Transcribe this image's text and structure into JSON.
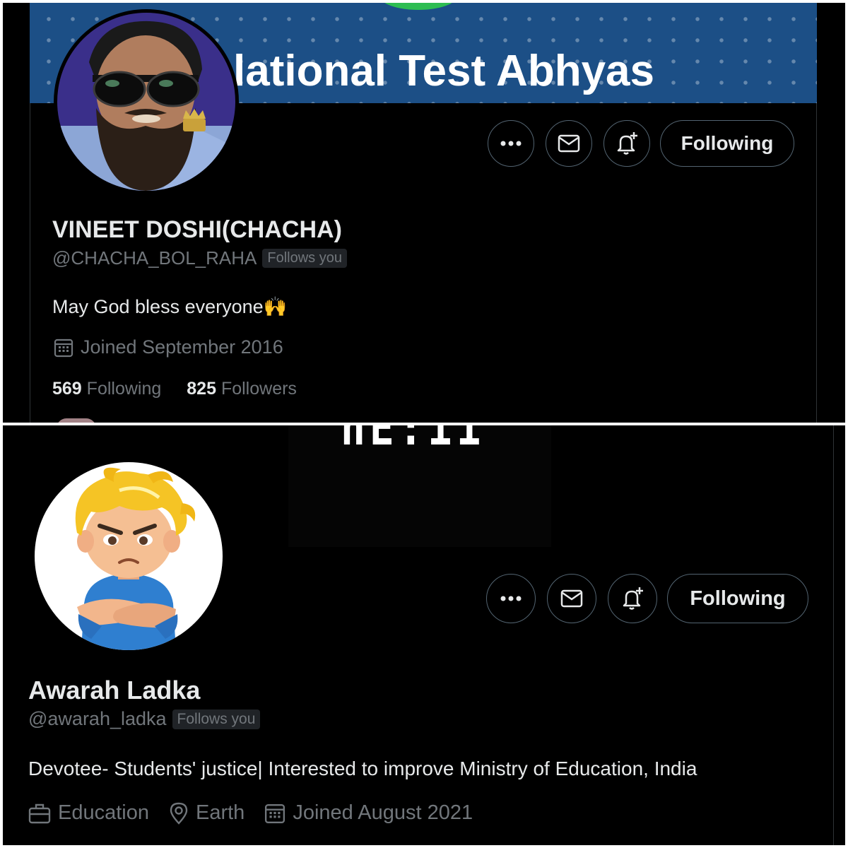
{
  "profiles": [
    {
      "banner_text": "lational Test Abhyas",
      "actions": {
        "more_label": "•••",
        "following_label": "Following"
      },
      "name": "VINEET DOSHI(CHACHA)",
      "handle": "@CHACHA_BOL_RAHA",
      "follows_you": "Follows you",
      "bio": "May God bless everyone🙌",
      "joined": "Joined September 2016",
      "following_count": "569",
      "following_label": "Following",
      "followers_count": "825",
      "followers_label": "Followers"
    },
    {
      "banner_text": "nE:11",
      "actions": {
        "more_label": "•••",
        "following_label": "Following"
      },
      "name": "Awarah Ladka",
      "handle": "@awarah_ladka",
      "follows_you": "Follows you",
      "bio": "Devotee- Students' justice| Interested to improve Ministry of Education, India",
      "category": "Education",
      "location": "Earth",
      "joined": "Joined August 2021"
    }
  ],
  "colors": {
    "background": "#000000",
    "text_primary": "#e7e9ea",
    "text_secondary": "#71767b",
    "banner_blue": "#1c4f86",
    "border": "#536471"
  },
  "icons": [
    "more-icon",
    "message-icon",
    "notification-bell-plus-icon",
    "calendar-icon",
    "briefcase-icon",
    "location-pin-icon"
  ]
}
